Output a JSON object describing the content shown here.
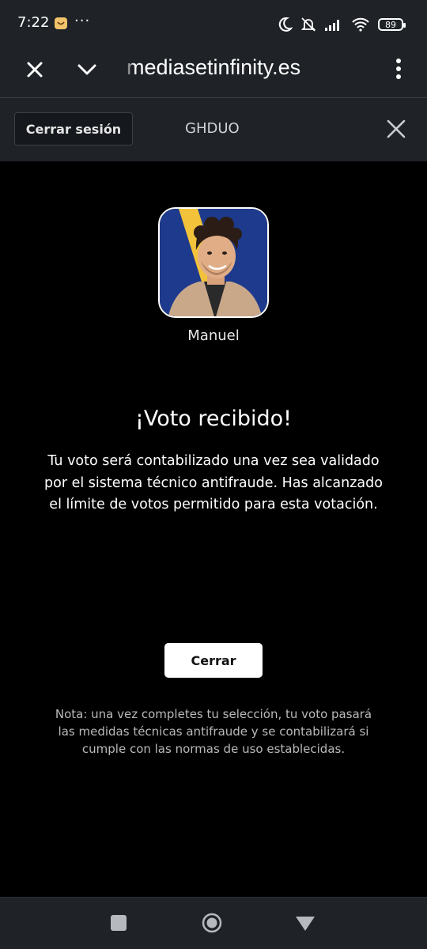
{
  "status_bar": {
    "time": "7:22",
    "more_indicator": "···",
    "battery_level": "89",
    "icons": [
      "moon-icon",
      "muted-bell-icon",
      "signal-icon",
      "wifi-icon",
      "battery-icon"
    ]
  },
  "browser": {
    "url": "mediasetinfinity.es",
    "close_icon": "close-icon",
    "collapse_icon": "chevron-down-icon",
    "menu_icon": "more-vertical-icon"
  },
  "toolbar": {
    "logout_label": "Cerrar sesión",
    "code": "GHDUO",
    "close_icon": "close-icon"
  },
  "vote": {
    "candidate_name": "Manuel",
    "title": "¡Voto recibido!",
    "message": "Tu voto será contabilizado una vez sea validado por el sistema técnico antifraude. Has alcanzado el límite de votos permitido para esta votación.",
    "close_label": "Cerrar",
    "note": "Nota: una vez completes tu selección, tu voto pasará las medidas técnicas antifraude y se contabilizará si cumple con las normas de uso establecidas."
  },
  "nav_bar": {
    "icons": [
      "recents-square-icon",
      "home-circle-icon",
      "back-triangle-icon"
    ]
  },
  "colors": {
    "chrome": "#1f2328",
    "background": "#000000",
    "text": "#ffffff",
    "muted_text": "#b9b9b9",
    "button_bg": "#ffffff",
    "avatar_bg": "#1e3a8c",
    "avatar_accent": "#f2c23a"
  }
}
